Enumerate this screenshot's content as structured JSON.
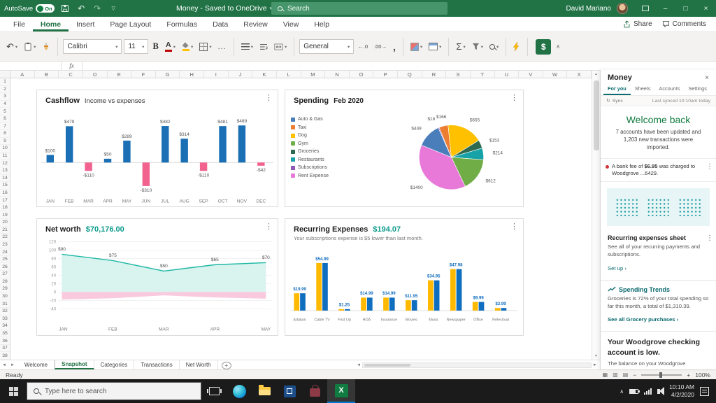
{
  "colors": {
    "excel_green": "#217346",
    "welcome_green": "#107c41",
    "pane_teal": "#0b6a6e",
    "alert_red": "#d13438",
    "taskbar_accent": "#0078d7"
  },
  "titlebar": {
    "autosave_label": "AutoSave",
    "autosave_state": "On",
    "doc_title": "Money - Saved to OneDrive",
    "search_placeholder": "Search",
    "user_name": "David Mariano"
  },
  "ribbon": {
    "tabs": [
      "File",
      "Home",
      "Insert",
      "Page Layout",
      "Formulas",
      "Data",
      "Review",
      "View",
      "Help"
    ],
    "active_tab": "Home",
    "share_label": "Share",
    "comments_label": "Comments",
    "font_name": "Calibri",
    "font_size": "11",
    "number_format": "General",
    "bold_label": "B",
    "font_color_label": "A",
    "more_label": "...",
    "sum_label": "Σ",
    "decimal_left": "←.0",
    "decimal_right": ".00→",
    "comma_style": ",",
    "money_button_label": "$"
  },
  "formula_bar": {
    "fx_label": "fx",
    "name_box": ""
  },
  "grid": {
    "columns": [
      "A",
      "B",
      "C",
      "D",
      "E",
      "F",
      "G",
      "H",
      "I",
      "J",
      "K",
      "L",
      "M",
      "N",
      "O",
      "P",
      "Q",
      "R",
      "S",
      "T",
      "U",
      "V",
      "W",
      "X"
    ],
    "row_count": 38
  },
  "chart_data": [
    {
      "id": "cashflow",
      "type": "bar",
      "title": "Cashflow",
      "subtitle": "Income vs expenses",
      "categories": [
        "JAN",
        "FEB",
        "MAR",
        "APR",
        "MAY",
        "JUN",
        "JUL",
        "AUG",
        "SEP",
        "OCT",
        "NOV",
        "DEC"
      ],
      "values": [
        100,
        479,
        -110,
        50,
        289,
        -310,
        482,
        314,
        -110,
        481,
        489,
        -42
      ],
      "labels": [
        "$100",
        "$479",
        "-$110",
        "$50",
        "$289",
        "-$310",
        "$482",
        "$314",
        "-$110",
        "$481",
        "$489",
        "-$42"
      ],
      "positive_color": "#1b6fb5",
      "negative_color": "#f2628f"
    },
    {
      "id": "spending",
      "type": "pie",
      "title": "Spending",
      "subtitle": "Feb 2020",
      "legend": [
        {
          "label": "Auto & Gas",
          "color": "#4a7ebb"
        },
        {
          "label": "Taxi",
          "color": "#ed7d31"
        },
        {
          "label": "Dog",
          "color": "#ffc000"
        },
        {
          "label": "Gym",
          "color": "#70ad47"
        },
        {
          "label": "Groceries",
          "color": "#2d6a4f"
        },
        {
          "label": "Restaurants",
          "color": "#17a2a8"
        },
        {
          "label": "Subscriptions",
          "color": "#8c5bb8"
        },
        {
          "label": "Rent Expense",
          "color": "#e879d8"
        }
      ],
      "slices": [
        {
          "label": "$449",
          "value": 449,
          "color": "#4a7ebb"
        },
        {
          "label": "$18",
          "value": 18,
          "color": "#8c5bb8"
        },
        {
          "label": "$166",
          "value": 166,
          "color": "#ed7d31"
        },
        {
          "label": "$655",
          "value": 655,
          "color": "#ffc000"
        },
        {
          "label": "$153",
          "value": 153,
          "color": "#2d6a4f"
        },
        {
          "label": "$214",
          "value": 214,
          "color": "#17a2a8"
        },
        {
          "label": "$612",
          "value": 612,
          "color": "#70ad47"
        },
        {
          "label": "$1400",
          "value": 1400,
          "color": "#e879d8"
        }
      ],
      "start_angle": -158
    },
    {
      "id": "networth",
      "type": "area",
      "title": "Net worth",
      "value": "$70,176.00",
      "categories": [
        "JAN",
        "FEB",
        "MAR",
        "APR",
        "MAY"
      ],
      "values": [
        90,
        75,
        50,
        65,
        70
      ],
      "labels": [
        "$90",
        "$75",
        "$50",
        "$65",
        "$70"
      ],
      "yticks": [
        120,
        100,
        80,
        60,
        40,
        20,
        0,
        -20,
        -40
      ],
      "ylim": [
        -40,
        120
      ],
      "line_color": "#1db8a5",
      "area_color": "#d9f3ee",
      "negative_values": [
        -18,
        -15,
        -8,
        -13,
        -16
      ],
      "negative_color": "#f9c9dd"
    },
    {
      "id": "recurring",
      "type": "grouped-bar",
      "title": "Recurring Expenses",
      "value": "$194.07",
      "subtitle": "Your subscriptions expense is $5 lower than last month.",
      "categories": [
        "Adatum",
        "Cable TV",
        "First Up",
        "HOA",
        "Insurance",
        "Movies",
        "Music",
        "Newspaper",
        "Office",
        "Relecloud"
      ],
      "values": [
        19.99,
        54.99,
        1.25,
        14.99,
        14.99,
        11.95,
        34.95,
        47.98,
        9.99,
        2.99
      ],
      "labels": [
        "$19.99",
        "$54.99",
        "$1.25",
        "$14.99",
        "$14.99",
        "$11.95",
        "$34.95",
        "$47.98",
        "$9.99",
        "$2.99"
      ],
      "series_colors": [
        "#ffb900",
        "#106ebe"
      ],
      "label_color": "#106ebe"
    }
  ],
  "sheet_tabs": {
    "tabs": [
      "Welcome",
      "Snapshot",
      "Categories",
      "Transactions",
      "Net Worth"
    ],
    "active": "Snapshot"
  },
  "status_bar": {
    "mode": "Ready",
    "zoom": "100%"
  },
  "task_pane": {
    "title": "Money",
    "tabs": [
      "For you",
      "Sheets",
      "Accounts",
      "Settings"
    ],
    "active_tab": "For you",
    "sync_label": "Sync",
    "sync_status": "Last synced 10:10am today",
    "welcome_heading": "Welcome back",
    "welcome_text": "7 accounts have been updated and 1,203 new transactions were imported.",
    "alert_text_1": "A bank fee of ",
    "alert_amount": "$6.95",
    "alert_text_2": " was charged to Woodgrove ...6429.",
    "recurring": {
      "heading": "Recurring expenses sheet",
      "body": "See all of your recurring payments and subscriptions.",
      "link": "Set up ›"
    },
    "trends": {
      "heading": "Spending Trends",
      "body": "Groceries is 72% of your total spending so far this month, a total of $1,310.39.",
      "link": "See all Grocery purchases ›"
    },
    "low_balance": {
      "heading": "Your Woodgrove checking account is low.",
      "body": "The balance on your Woodgrove"
    }
  },
  "taskbar": {
    "search_placeholder": "Type here to search",
    "time": "10:10 AM",
    "date": "4/2/2020"
  }
}
